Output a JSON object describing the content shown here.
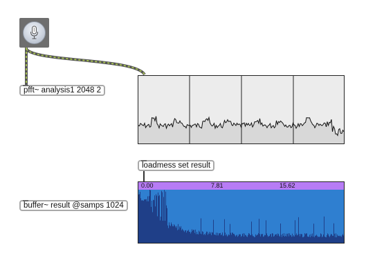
{
  "objects": {
    "pfft": "pfft~ analysis1 2048 2",
    "loadmess": "loadmess set result",
    "buffer": "buffer~ result @samps 1024"
  },
  "buffer_view": {
    "ruler_labels": [
      "0.00",
      "7.81",
      "15.62"
    ]
  },
  "colors": {
    "ruler": "#b77cf5",
    "waveform_fill": "#2f7fd0",
    "waveform_peaks": "#1f3f88",
    "scope_background": "#ececec",
    "signal_cable": "#a5bf52"
  },
  "icons": {
    "mic_button": "microphone-icon"
  }
}
